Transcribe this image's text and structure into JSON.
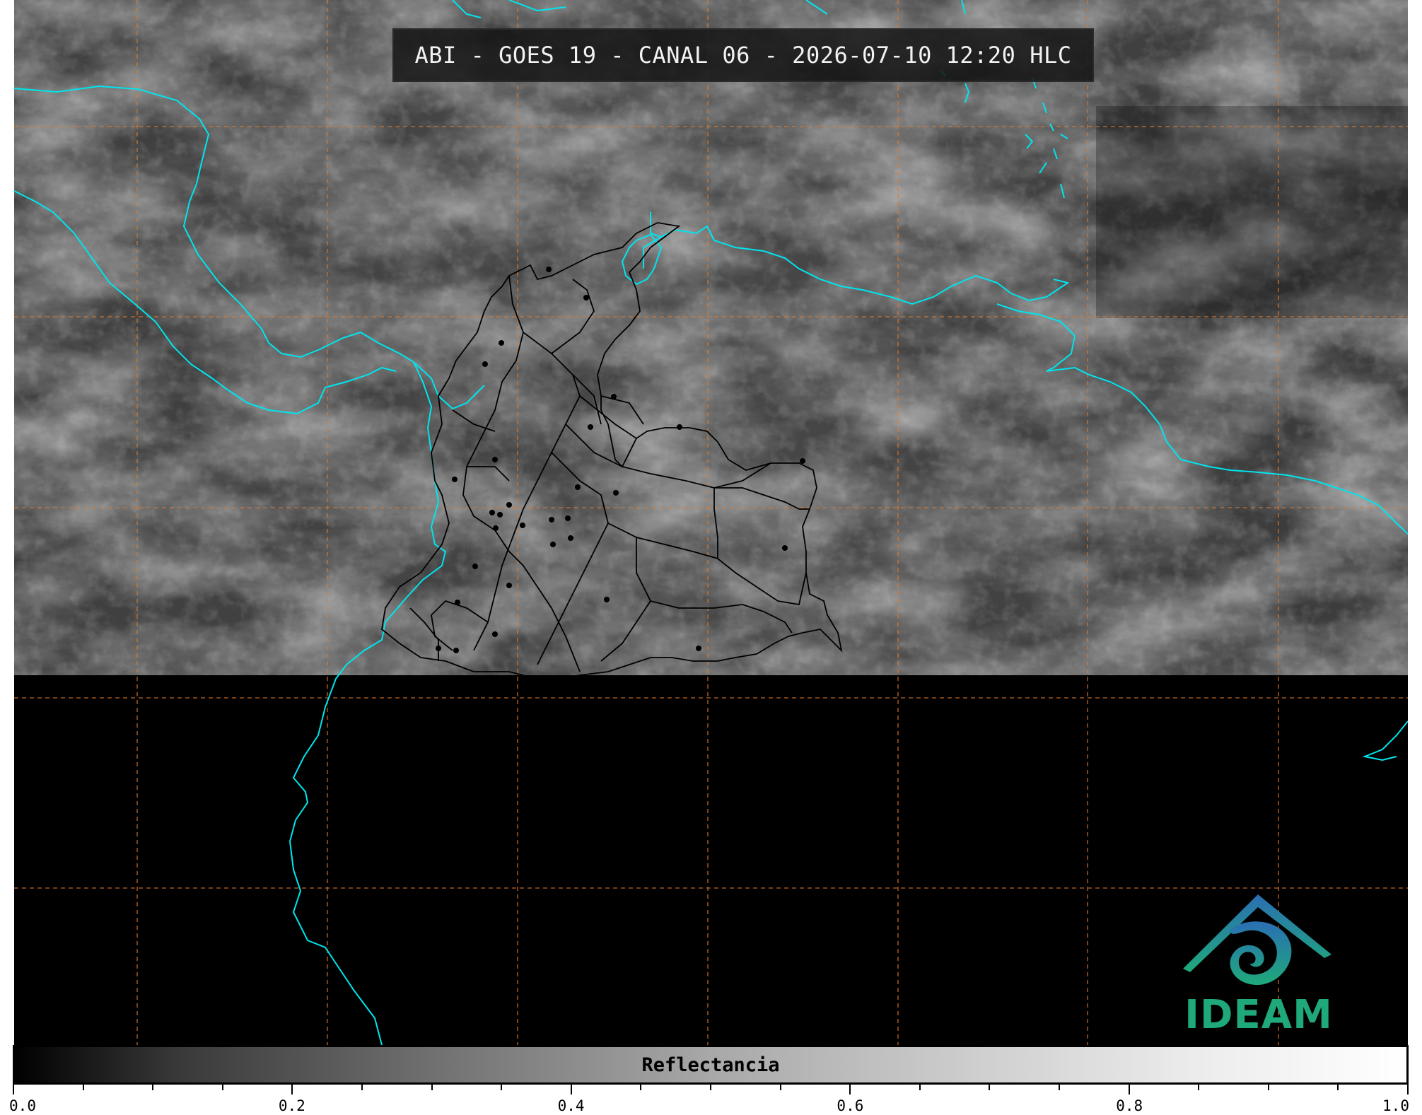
{
  "title": "ABI - GOES 19 - CANAL 06 - 2026-07-10 12:20 HLC",
  "colorbar": {
    "label": "Reflectancia",
    "ticks": [
      "0.0",
      "0.2",
      "0.4",
      "0.6",
      "0.8",
      "1.0"
    ],
    "min": 0.0,
    "max": 1.0,
    "colormap": [
      "#000000",
      "#ffffff"
    ]
  },
  "logo": {
    "text": "IDEAM",
    "colors": {
      "top": "#2a6fb3",
      "bottom": "#1fa97a"
    }
  },
  "colors": {
    "coastline": "#00e5ee",
    "borders": "#000000",
    "graticule": "#e07a2a",
    "no_data": "#000000"
  }
}
